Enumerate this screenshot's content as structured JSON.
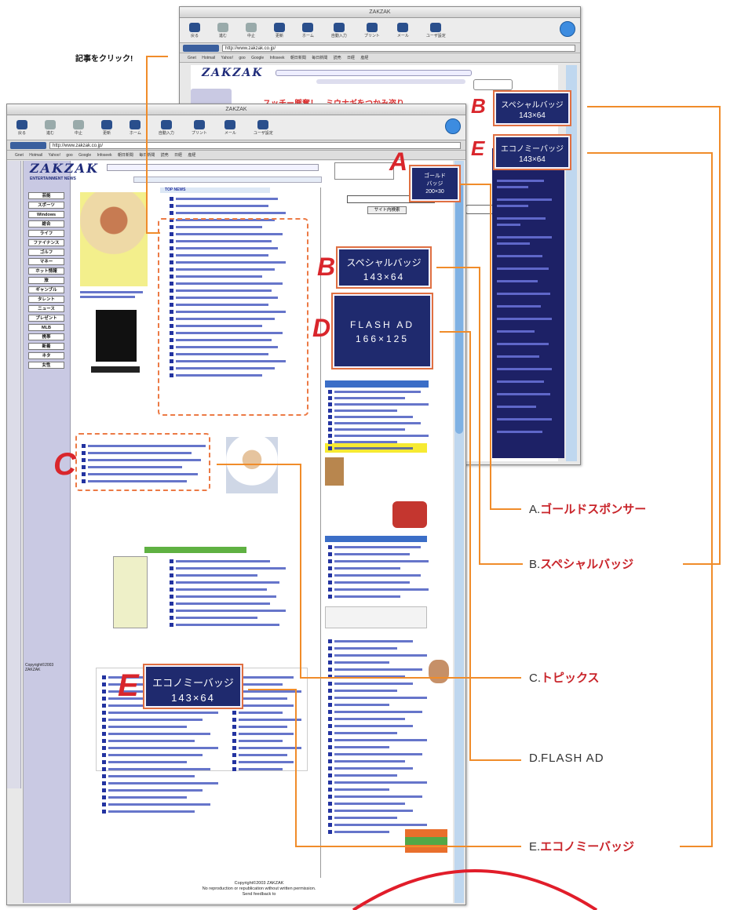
{
  "callout_click": "記事をクリック!",
  "letters": {
    "a": "A",
    "b": "B",
    "c": "C",
    "d": "D",
    "e": "E"
  },
  "back_window": {
    "title": "ZAKZAK",
    "url": "http://www.zakzak.co.jp/",
    "headline": "スッチー興奮！　ミウナギをつかみ盗り",
    "toolbar": [
      "戻る",
      "進む",
      "中止",
      "更新",
      "ホーム",
      "自動入力",
      "プリント",
      "メール",
      "ユーザ設定"
    ],
    "favorites": "Gnet  Hotmail  Yahoo!  goo  Google  Infoseek  朝日新聞  毎日新聞  読売  日経  産経"
  },
  "front_window": {
    "title": "ZAKZAK",
    "url": "http://www.zakzak.co.jp/",
    "toolbar": [
      "戻る",
      "進む",
      "中止",
      "更新",
      "ホーム",
      "自動入力",
      "プリント",
      "メール",
      "ユーザ設定"
    ],
    "favorites": "Gnet  Hotmail  Yahoo!  goo  Google  Infoseek  朝日新聞  毎日新聞  読売  日経  産経",
    "logo": "ZAKZAK",
    "logo_sub": "ENTERTAINMENT NEWS",
    "top_news_heading": "TOP NEWS",
    "nav": [
      "芸能",
      "スポーツ",
      "Windows",
      "総合",
      "ライフ",
      "ファイナンス",
      "ゴルフ",
      "マネー",
      "ホット情報",
      "旅",
      "ギャンブル",
      "タレント",
      "ニュース",
      "プレゼント",
      "MLB",
      "携帯",
      "新着",
      "ネタ",
      "女性"
    ],
    "search_button": "サイト内検索",
    "search_placeholder": "",
    "copyright": "Copyright©2003 ZAKZAK",
    "copyright_note": "No reproduction or republication without written permission.",
    "feedback": "Send feedback to",
    "sidebar_copyright": "Copyright©2003 ZAKZAK"
  },
  "ads": {
    "gold": {
      "l1": "ゴールド",
      "l2": "バッジ",
      "l3": "200×30"
    },
    "special_front": {
      "l1": "スペシャルバッジ",
      "l2": "143×64"
    },
    "special_back": {
      "l1": "スペシャルバッジ",
      "l2": "143×64"
    },
    "flash": {
      "l1": "FLASH AD",
      "l2": "166×125"
    },
    "economy_back": {
      "l1": "エコノミーバッジ",
      "l2": "143×64"
    },
    "economy_front": {
      "l1": "エコノミーバッジ",
      "l2": "143×64"
    }
  },
  "captions": [
    {
      "prefix": "A.",
      "label": "ゴールドスポンサー"
    },
    {
      "prefix": "B.",
      "label": "スペシャルバッジ"
    },
    {
      "prefix": "C.",
      "label": "トピックス"
    },
    {
      "prefix": "D.",
      "label": "FLASH AD"
    },
    {
      "prefix": "E.",
      "label": "エコノミーバッジ"
    }
  ],
  "colors": {
    "accent": "#f08c2a",
    "red": "#d9262c",
    "navy": "#1f2a6e"
  }
}
